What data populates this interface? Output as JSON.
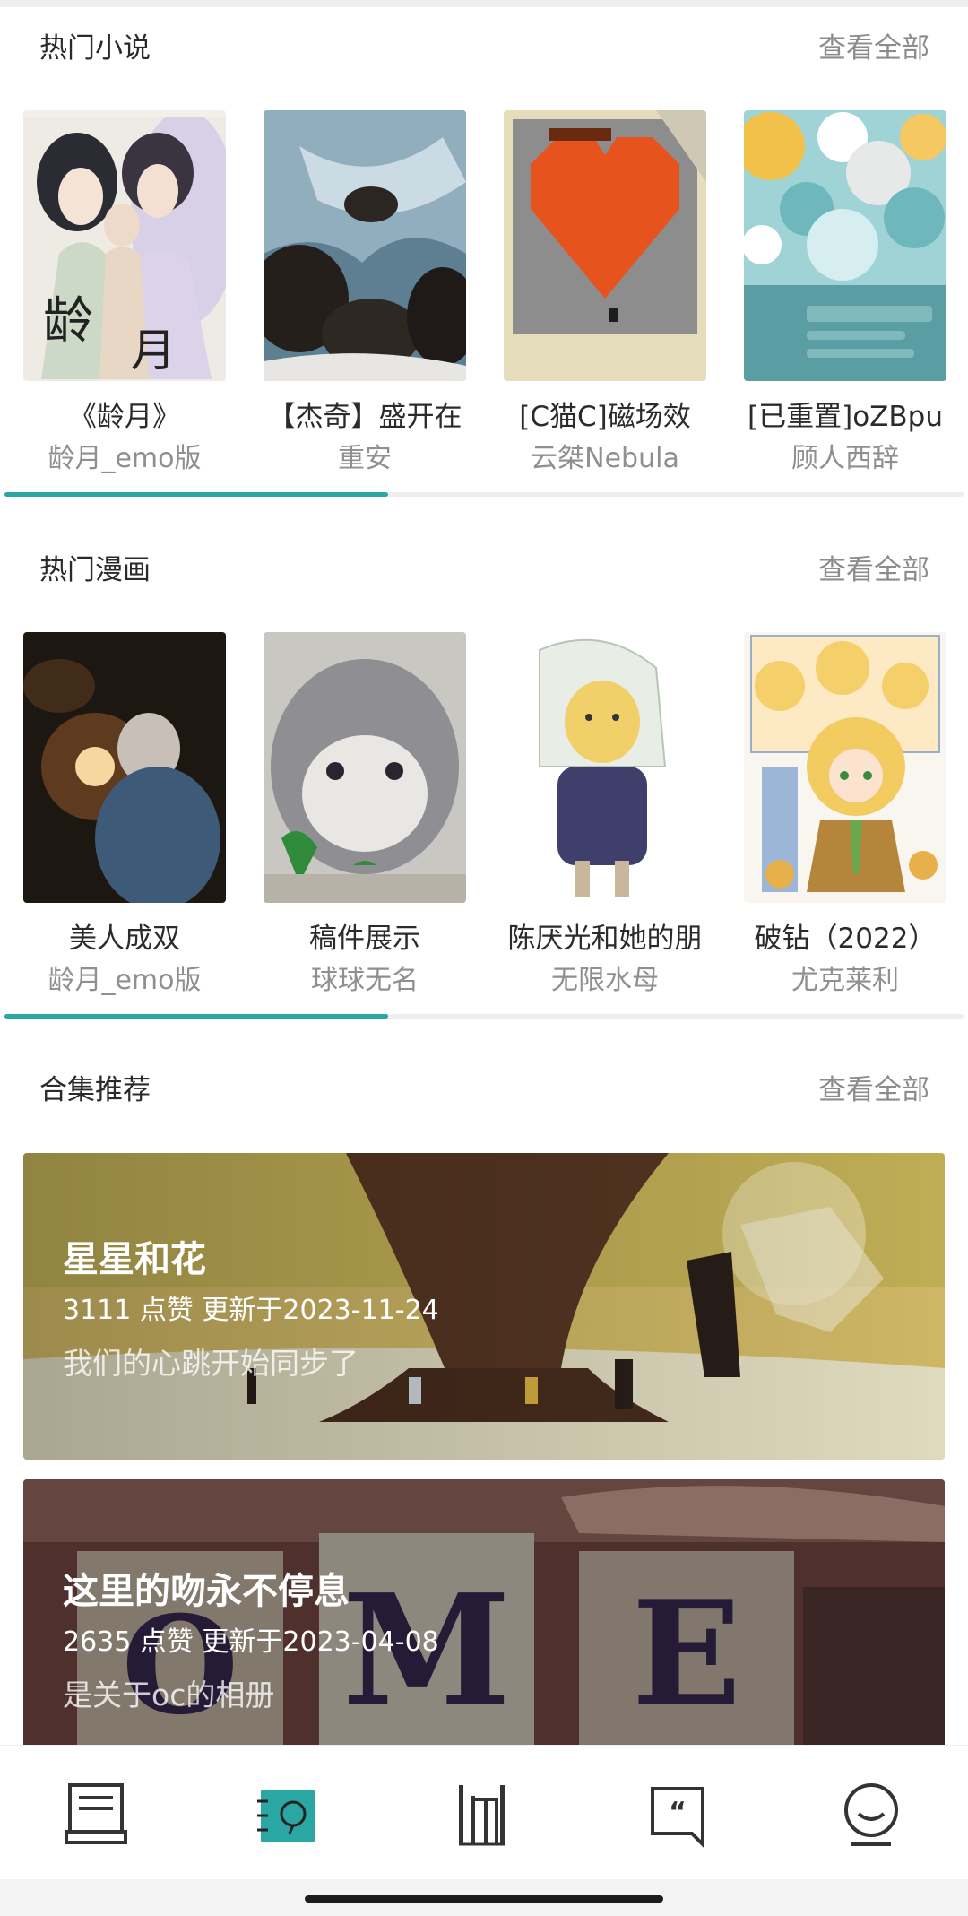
{
  "sections": {
    "novels": {
      "title": "热门小说",
      "see_all": "查看全部",
      "items": [
        {
          "title": "《龄月》",
          "author": "龄月_emo版",
          "cover_text": [
            "龄",
            "月"
          ]
        },
        {
          "title": "【杰奇】盛开在",
          "author": "重安"
        },
        {
          "title": "[C猫C]磁场效",
          "author": "云桀Nebula"
        },
        {
          "title": "[已重置]oZBpu",
          "author": "顾人西辞"
        }
      ],
      "scroll_progress": 0.4
    },
    "comics": {
      "title": "热门漫画",
      "see_all": "查看全部",
      "items": [
        {
          "title": "美人成双",
          "author": "龄月_emo版"
        },
        {
          "title": "稿件展示",
          "author": "球球无名"
        },
        {
          "title": "陈厌光和她的朋",
          "author": "无限水母"
        },
        {
          "title": "破钻（2022）",
          "author": "尤克莱利"
        }
      ],
      "scroll_progress": 0.4
    },
    "collections": {
      "title": "合集推荐",
      "see_all": "查看全部",
      "items": [
        {
          "title": "星星和花",
          "meta": "3111 点赞 更新于2023-11-24",
          "desc": "我们的心跳开始同步了"
        },
        {
          "title": "这里的吻永不停息",
          "meta": "2635 点赞 更新于2023-04-08",
          "desc": "是关于oc的相册",
          "block_letters": [
            "O",
            "M",
            "E"
          ]
        }
      ]
    }
  },
  "tabbar": {
    "tabs": [
      {
        "icon": "bookshelf-icon",
        "active": false
      },
      {
        "icon": "discover-icon",
        "active": true
      },
      {
        "icon": "library-icon",
        "active": false
      },
      {
        "icon": "quote-icon",
        "active": false
      },
      {
        "icon": "profile-icon",
        "active": false
      }
    ]
  },
  "colors": {
    "accent": "#2aa6a3",
    "muted": "#8f8f8f"
  }
}
